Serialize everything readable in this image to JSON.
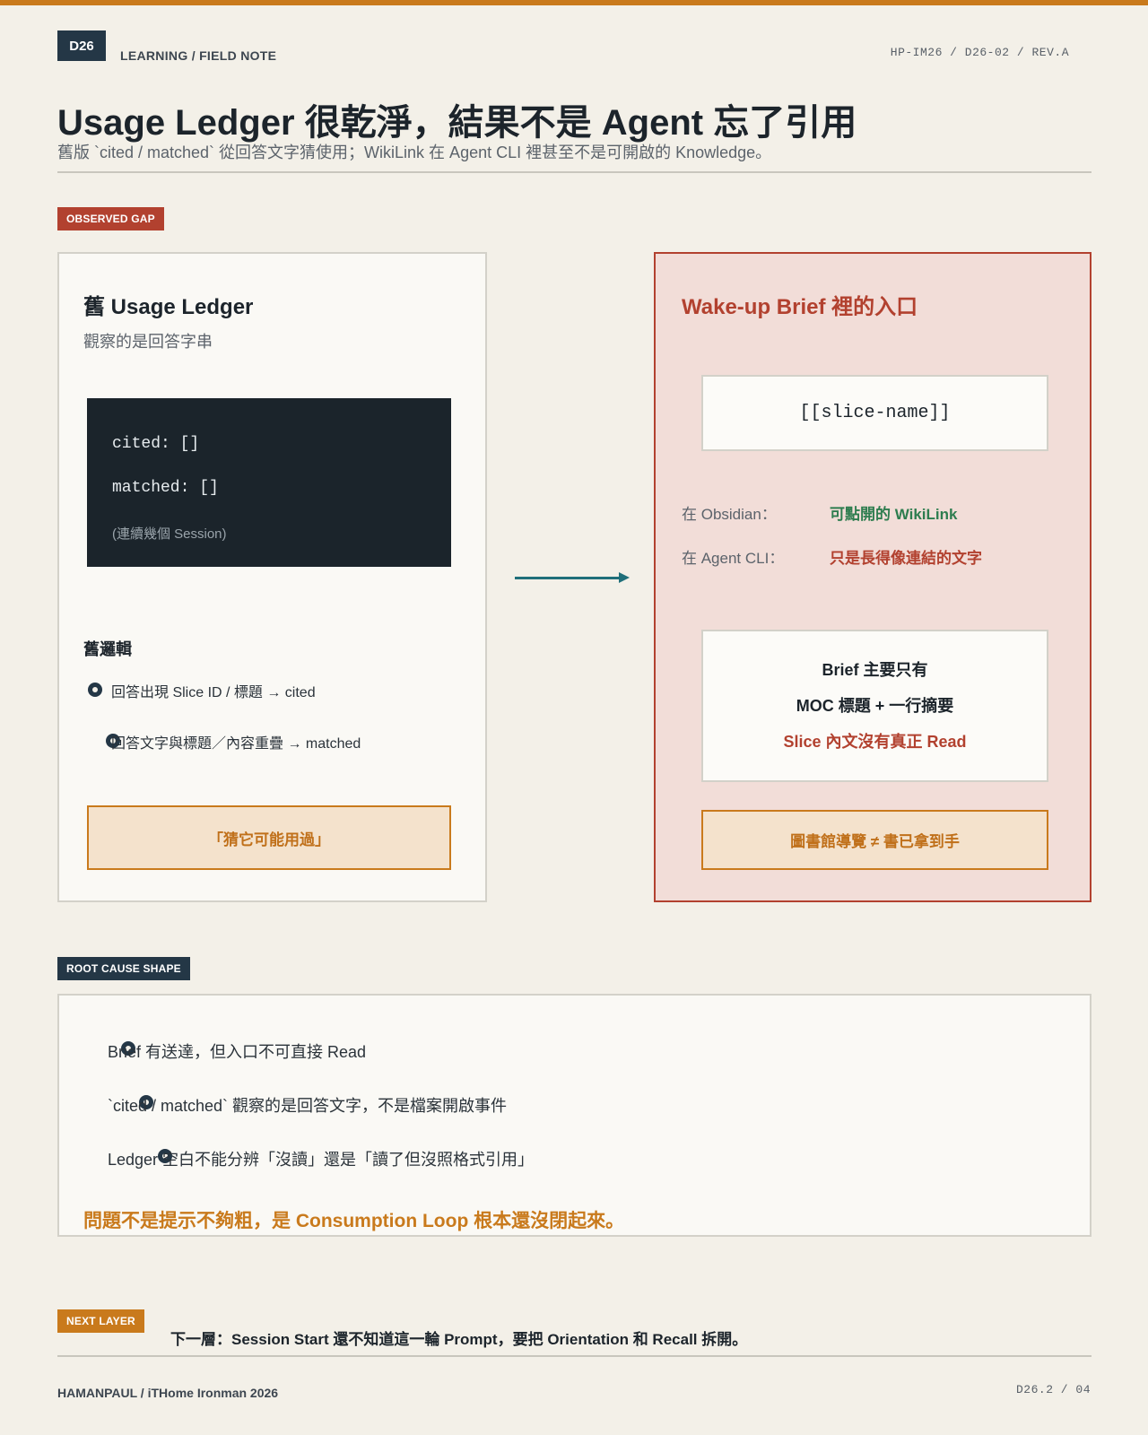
{
  "header": {
    "day_badge": "D26",
    "kicker": "LEARNING / FIELD NOTE",
    "doc_ref": "HP-IM26 / D26-02 / REV.A",
    "title": "Usage Ledger 很乾淨，結果不是 Agent 忘了引用",
    "subtitle": "舊版 `cited / matched` 從回答文字猜使用；WikiLink 在 Agent CLI 裡甚至不是可開啟的 Knowledge。"
  },
  "observed_gap": {
    "tag": "OBSERVED GAP",
    "left_card": {
      "title": "舊 Usage Ledger",
      "subtitle": "觀察的是回答字串",
      "code": {
        "line1": "cited: []",
        "line2": "matched: []",
        "note": "(連續幾個 Session)"
      },
      "logic_heading": "舊邏輯",
      "bullets": [
        "回答出現 Slice ID / 標題 → cited",
        "回答文字與標題／內容重疊 → matched"
      ],
      "callout": "「猜它可能用過」"
    },
    "right_card": {
      "title": "Wake-up Brief 裡的入口",
      "link_example": "[[slice-name]]",
      "rows": [
        {
          "label": "在 Obsidian：",
          "value": "可點開的 WikiLink",
          "color": "#2e7d4f"
        },
        {
          "label": "在 Agent CLI：",
          "value": "只是長得像連結的文字",
          "color": "#b2412f"
        }
      ],
      "brief": {
        "line1": "Brief 主要只有",
        "line2": "MOC 標題 + 一行摘要",
        "line3": "Slice 內文沒有真正 Read"
      },
      "callout": "圖書館導覽 ≠ 書已拿到手"
    }
  },
  "root_cause": {
    "tag": "ROOT CAUSE SHAPE",
    "bullets": [
      "Brief 有送達，但入口不可直接 Read",
      "`cited / matched` 觀察的是回答文字，不是檔案開啟事件",
      "Ledger 空白不能分辨「沒讀」還是「讀了但沒照格式引用」"
    ],
    "conclusion": "問題不是提示不夠粗，是 Consumption Loop 根本還沒閉起來。"
  },
  "next_layer": {
    "tag": "NEXT LAYER",
    "text": "下一層：Session Start 還不知道這一輪 Prompt，要把 Orientation 和 Recall 拆開。"
  },
  "footer": {
    "left": "HAMANPAUL / iTHome Ironman 2026",
    "right": "D26.2 / 04"
  },
  "colors": {
    "accent_orange": "#c97a1c",
    "accent_red": "#b2412f",
    "navy": "#243746",
    "teal_arrow": "#1f6f7a",
    "green": "#2e7d4f"
  }
}
